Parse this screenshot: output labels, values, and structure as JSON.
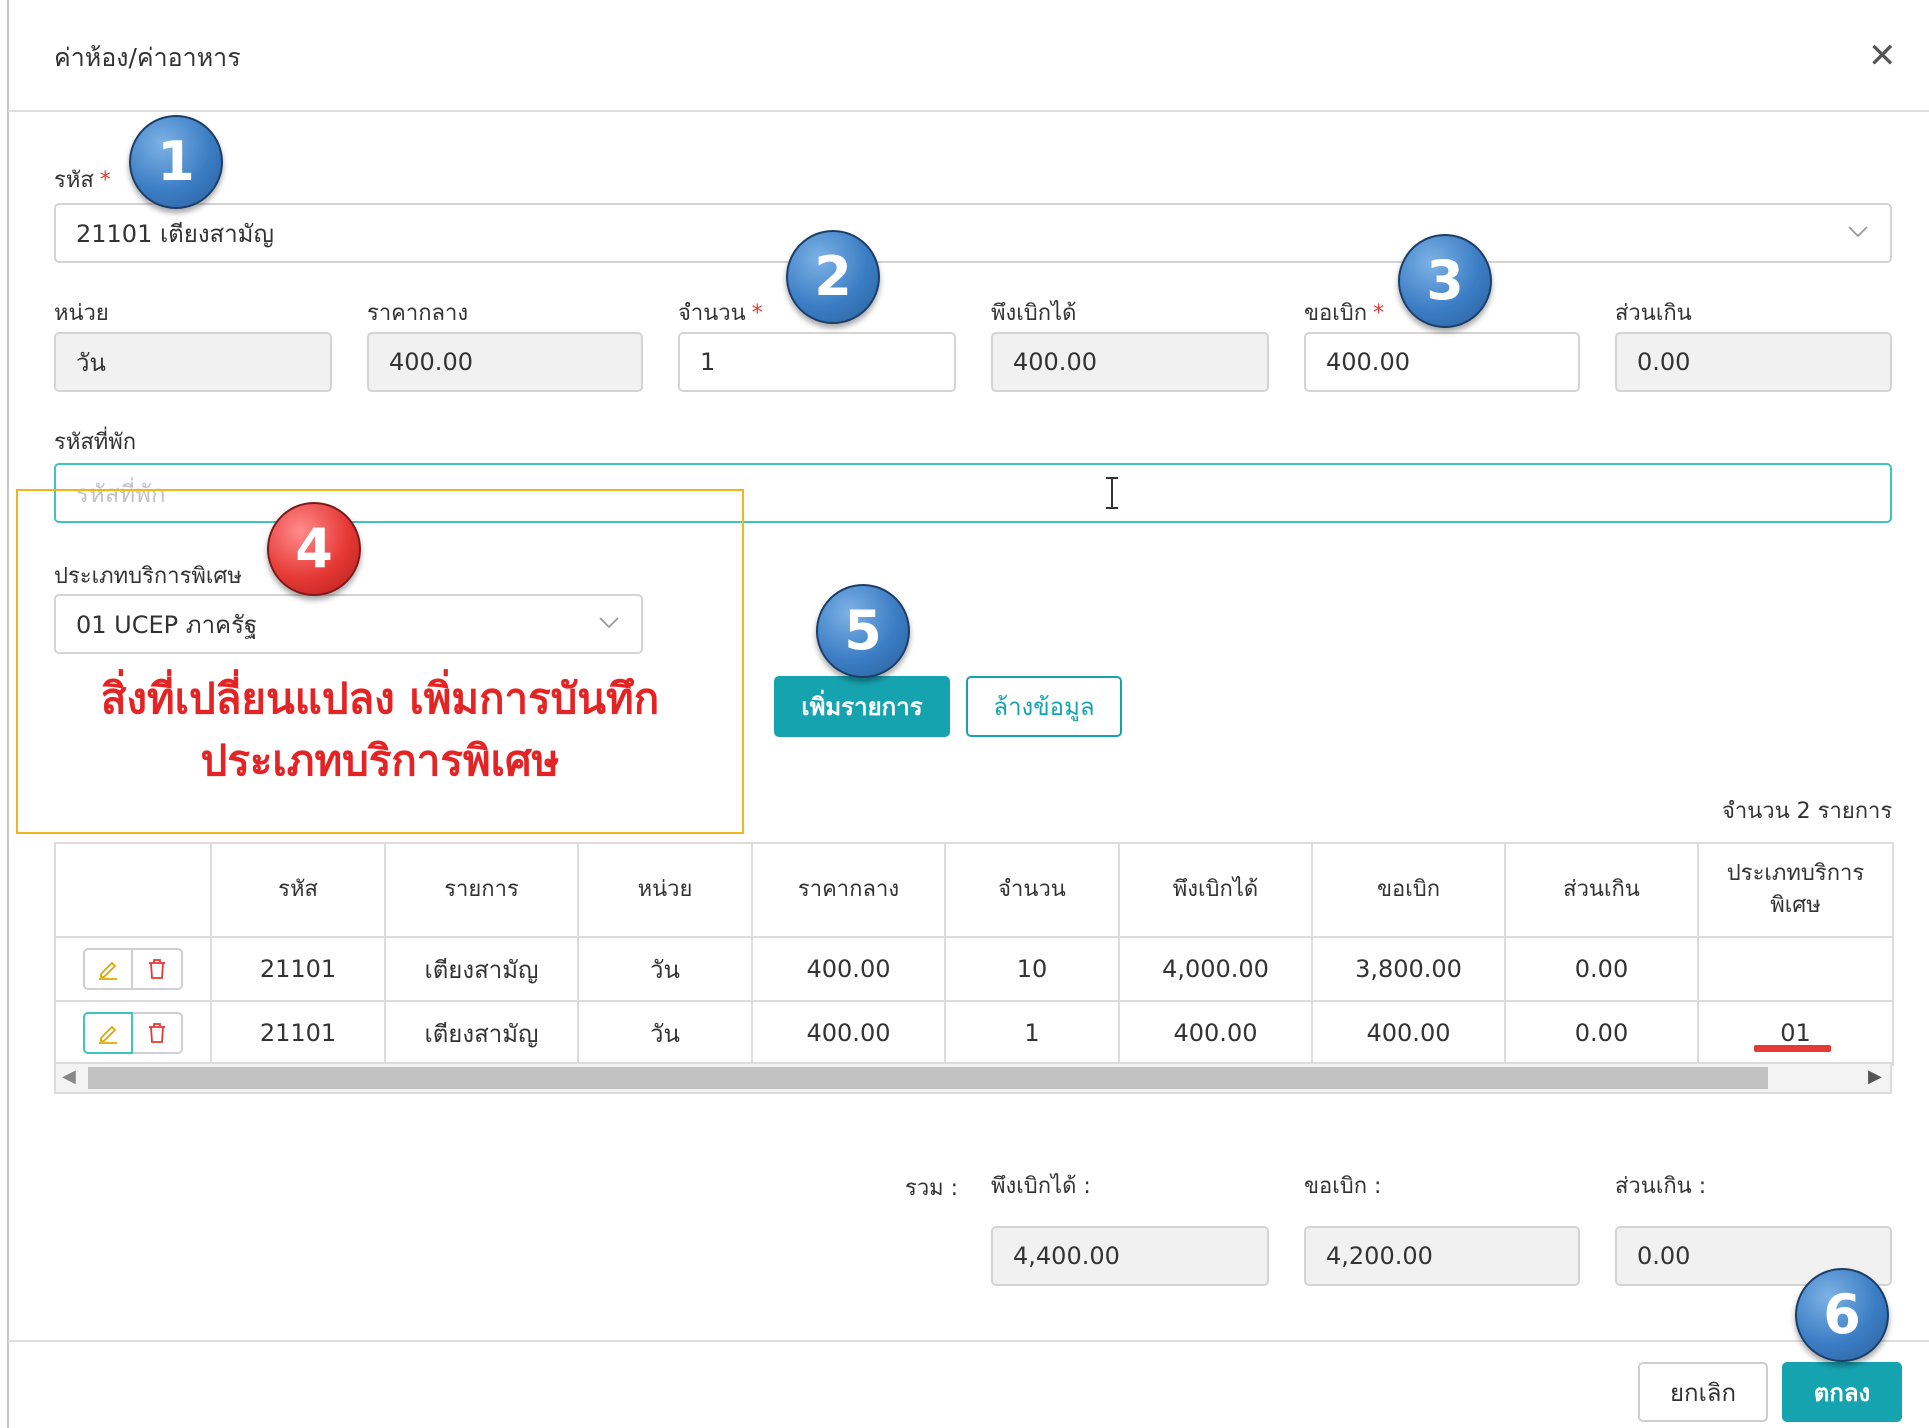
{
  "dialog": {
    "title": "ค่าห้อง/ค่าอาหาร",
    "close_glyph": "✕",
    "code_label": "รหัส",
    "required_mark": "*",
    "code_value": "21101 เตียงสามัญ",
    "unit_label": "หน่วย",
    "unit_value": "วัน",
    "ref_price_label": "ราคากลาง",
    "ref_price_value": "400.00",
    "qty_label": "จำนวน",
    "qty_value": "1",
    "entitled_label": "พึงเบิกได้",
    "entitled_value": "400.00",
    "claim_label": "ขอเบิก",
    "claim_value": "400.00",
    "excess_label": "ส่วนเกิน",
    "excess_value": "0.00",
    "room_code_label": "รหัสที่พัก",
    "room_code_placeholder": "รหัสที่พัก",
    "special_service_label": "ประเภทบริการพิเศษ",
    "special_service_value": "01 UCEP ภาครัฐ",
    "add_button": "เพิ่มรายการ",
    "clear_button": "ล้างข้อมูล",
    "item_count": "จำนวน 2 รายการ"
  },
  "annotation": {
    "badges": [
      "1",
      "2",
      "3",
      "4",
      "5",
      "6"
    ],
    "note_line1": "สิ่งที่เปลี่ยนแปลง เพิ่มการบันทึก",
    "note_line2": "ประเภทบริการพิเศษ",
    "colors": {
      "badge_blue": "#3b7dc4",
      "badge_red": "#e53935",
      "box": "#f2b51d",
      "note": "#e42424"
    }
  },
  "table": {
    "headers": {
      "code": "รหัส",
      "item": "รายการ",
      "unit": "หน่วย",
      "ref_price": "ราคากลาง",
      "qty": "จำนวน",
      "entitled": "พึงเบิกได้",
      "claim": "ขอเบิก",
      "excess": "ส่วนเกิน",
      "special": "ประเภทบริการพิเศษ"
    },
    "rows": [
      {
        "code": "21101",
        "item": "เตียงสามัญ",
        "unit": "วัน",
        "ref_price": "400.00",
        "qty": "10",
        "entitled": "4,000.00",
        "claim": "3,800.00",
        "excess": "0.00",
        "special": ""
      },
      {
        "code": "21101",
        "item": "เตียงสามัญ",
        "unit": "วัน",
        "ref_price": "400.00",
        "qty": "1",
        "entitled": "400.00",
        "claim": "400.00",
        "excess": "0.00",
        "special": "01"
      }
    ]
  },
  "totals": {
    "sum_label": "รวม :",
    "entitled_label": "พึงเบิกได้ :",
    "claim_label": "ขอเบิก :",
    "excess_label": "ส่วนเกิน :",
    "entitled_value": "4,400.00",
    "claim_value": "4,200.00",
    "excess_value": "0.00"
  },
  "footer": {
    "cancel_button": "ยกเลิก",
    "ok_button": "ตกลง"
  },
  "theme": {
    "primary": "#16a3b0",
    "focus_border": "#3fc4bf",
    "required": "#e53935"
  }
}
